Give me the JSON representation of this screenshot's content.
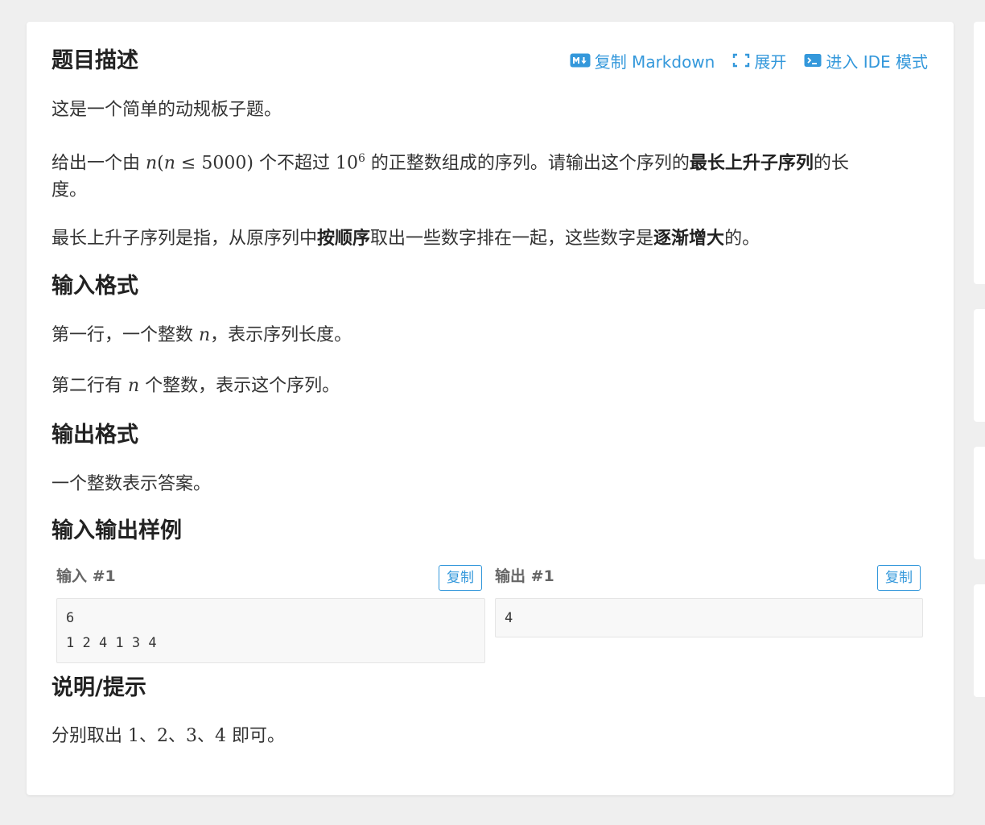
{
  "header": {
    "title": "题目描述",
    "actions": {
      "copy_markdown": "复制 Markdown",
      "expand": "展开",
      "enter_ide": "进入 IDE 模式"
    }
  },
  "description": {
    "p1": "这是一个简单的动规板子题。",
    "p2": {
      "t1": "给出一个由 ",
      "m_n": "n",
      "m_lparen": "(",
      "m_n2": "n",
      "m_le": " ≤ ",
      "m_5000": "5000",
      "m_rparen": ")",
      "t2": " 个不超过 ",
      "m_10": "10",
      "m_exp": "6",
      "t3": " 的正整数组成的序列。请输出这个序列的",
      "bold": "最长上升子序列",
      "t4": "的长",
      "line2": "度。"
    },
    "p3": {
      "t1": "最长上升子序列是指，从原序列中",
      "b1": "按顺序",
      "t2": "取出一些数字排在一起，这些数字是",
      "b2": "逐渐增大",
      "t3": "的。"
    }
  },
  "input_format": {
    "title": "输入格式",
    "l1_a": "第一行，一个整数 ",
    "l1_n": "n",
    "l1_b": "，表示序列长度。",
    "l2_a": "第二行有 ",
    "l2_n": "n",
    "l2_b": " 个整数，表示这个序列。"
  },
  "output_format": {
    "title": "输出格式",
    "text": "一个整数表示答案。"
  },
  "samples": {
    "title": "输入输出样例",
    "input_label": "输入 #1",
    "output_label": "输出 #1",
    "copy_label": "复制",
    "input_text": "6\n1 2 4 1 3 4",
    "output_text": "4"
  },
  "hint": {
    "title": "说明/提示",
    "t1": "分别取出 ",
    "m1": "1",
    "s1": "、",
    "m2": "2",
    "s2": "、",
    "m3": "3",
    "s3": "、",
    "m4": "4",
    "t2": " 即可。"
  },
  "colors": {
    "accent": "#3498db",
    "background": "#efefef",
    "card": "#ffffff",
    "text": "#333333"
  },
  "icons": [
    "markdown-icon",
    "expand-icon",
    "terminal-icon"
  ]
}
